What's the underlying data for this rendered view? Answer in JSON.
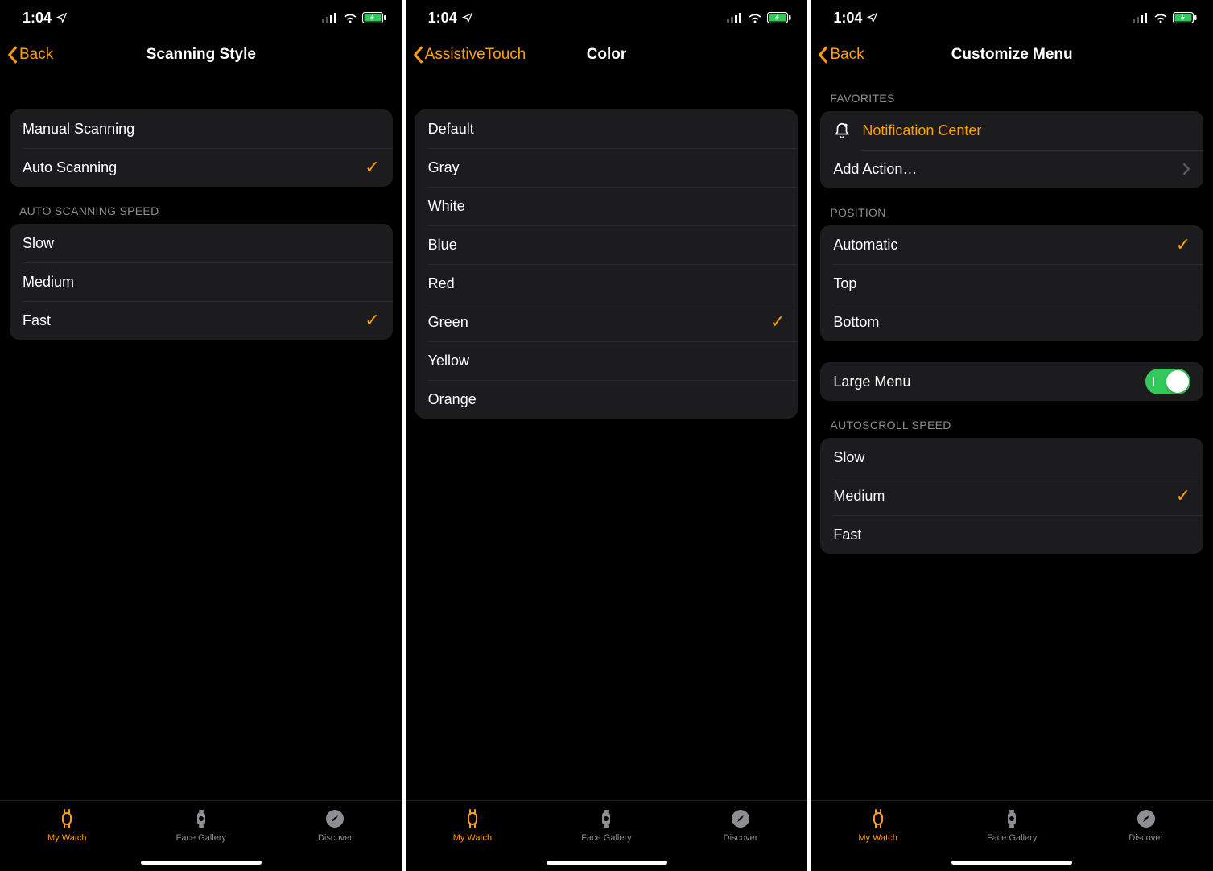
{
  "colors": {
    "accent": "#ff9f0a",
    "toggleOn": "#34c759",
    "muted": "#8e8e93"
  },
  "status": {
    "time": "1:04"
  },
  "tabs": {
    "items": [
      {
        "label": "My Watch",
        "icon": "watch-outline-icon"
      },
      {
        "label": "Face Gallery",
        "icon": "watch-face-icon"
      },
      {
        "label": "Discover",
        "icon": "compass-icon"
      }
    ],
    "activeIndex": 0
  },
  "screens": [
    {
      "backLabel": "Back",
      "title": "Scanning Style",
      "groups": [
        {
          "header": null,
          "rows": [
            {
              "label": "Manual Scanning",
              "selected": false
            },
            {
              "label": "Auto Scanning",
              "selected": true
            }
          ]
        },
        {
          "header": "AUTO SCANNING SPEED",
          "rows": [
            {
              "label": "Slow",
              "selected": false
            },
            {
              "label": "Medium",
              "selected": false
            },
            {
              "label": "Fast",
              "selected": true
            }
          ]
        }
      ]
    },
    {
      "backLabel": "AssistiveTouch",
      "title": "Color",
      "groups": [
        {
          "header": null,
          "rows": [
            {
              "label": "Default",
              "selected": false
            },
            {
              "label": "Gray",
              "selected": false
            },
            {
              "label": "White",
              "selected": false
            },
            {
              "label": "Blue",
              "selected": false
            },
            {
              "label": "Red",
              "selected": false
            },
            {
              "label": "Green",
              "selected": true
            },
            {
              "label": "Yellow",
              "selected": false
            },
            {
              "label": "Orange",
              "selected": false
            }
          ]
        }
      ]
    },
    {
      "backLabel": "Back",
      "title": "Customize Menu",
      "favorites": {
        "header": "FAVORITES",
        "notificationLabel": "Notification Center",
        "addActionLabel": "Add Action…"
      },
      "position": {
        "header": "POSITION",
        "rows": [
          {
            "label": "Automatic",
            "selected": true
          },
          {
            "label": "Top",
            "selected": false
          },
          {
            "label": "Bottom",
            "selected": false
          }
        ]
      },
      "largeMenu": {
        "label": "Large Menu",
        "on": true
      },
      "autoscroll": {
        "header": "AUTOSCROLL SPEED",
        "rows": [
          {
            "label": "Slow",
            "selected": false
          },
          {
            "label": "Medium",
            "selected": true
          },
          {
            "label": "Fast",
            "selected": false
          }
        ]
      }
    }
  ]
}
